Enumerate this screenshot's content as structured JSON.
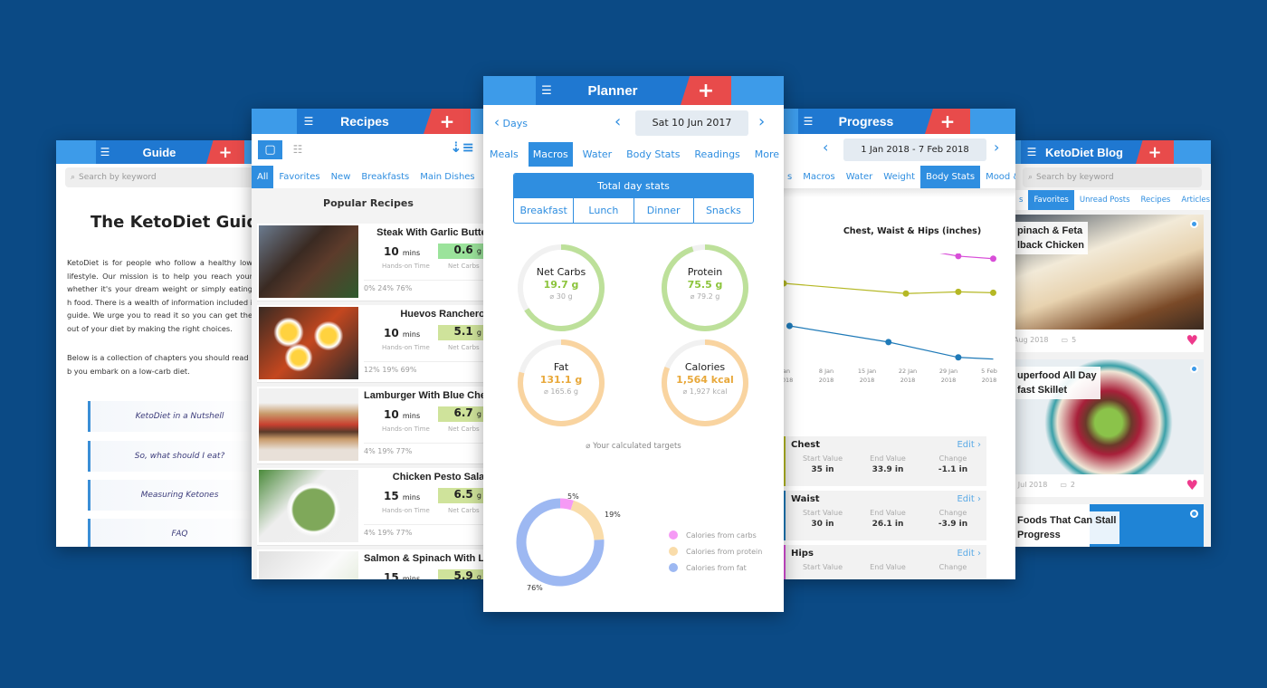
{
  "colors": {
    "background": "#0b4a85",
    "header": "#3d9be9",
    "accent": "#2f8ee0",
    "add": "#e84b4b",
    "carbs": "#f07cf0",
    "protein": "#f9d9a3",
    "fat": "#9db8f2",
    "ring_green": "#bde09a",
    "ring_orange": "#f9d4a0"
  },
  "guide": {
    "title": "Guide",
    "search_placeholder": "Search by keyword",
    "heading": "The KetoDiet Guide",
    "paragraph1": "KetoDiet is for people who follow a healthy low lifestyle. Our mission is to help you reach your whether it's your dream weight or simply eating h food. There is a wealth of information included i guide. We urge you to read it so you can get the out of your diet by making the right choices.",
    "paragraph2": "Below is a collection of chapters you should read b you embark on a low-carb diet.",
    "chapters": [
      "KetoDiet in a Nutshell",
      "So, what should I eat?",
      "Measuring Ketones",
      "FAQ"
    ]
  },
  "recipes": {
    "title": "Recipes",
    "tabs": [
      "All",
      "Favorites",
      "New",
      "Breakfasts",
      "Main Dishes"
    ],
    "active_tab": 0,
    "section_title": "Popular Recipes",
    "time_label": "Hands-on Time",
    "carbs_label": "Net Carbs",
    "items": [
      {
        "name": "Steak With Garlic Butter",
        "time": "10",
        "unit": "mins",
        "carbs": "0.6",
        "carb_unit": "g",
        "macros": "0%   24%   76%",
        "carb_color": "#9be39b",
        "img": "linear-gradient(135deg,#6b7b8f,#3a2a22 40%,#5c3b2b 60%,#2e5a2e)"
      },
      {
        "name": "Huevos Rancheros",
        "time": "10",
        "unit": "mins",
        "carbs": "5.1",
        "carb_unit": "g",
        "macros": "12%   19%   69%",
        "carb_color": "#cfe39b",
        "img": "radial-gradient(circle at 30% 35%,#ffd23f 9%,#fff 14%,transparent 18%),radial-gradient(circle at 70% 40%,#ffd23f 9%,#fff 14%,transparent 18%),radial-gradient(circle at 40% 70%,#ffd23f 9%,#fff 14%,transparent 18%),linear-gradient(135deg,#3a2a22,#c4471f 50%,#2a2a2a)"
      },
      {
        "name": "Lamburger With Blue Chee",
        "time": "10",
        "unit": "mins",
        "carbs": "6.7",
        "carb_unit": "g",
        "macros": "4%   19%   77%",
        "carb_color": "#cfe39b",
        "img": "linear-gradient(180deg,#f1f1f1 20%,#c89a6a 35%,#c84030 50%,#5a3a2a 60%,#c89a6a 70%,#e8e0d8 85%)"
      },
      {
        "name": "Chicken Pesto Salad",
        "time": "15",
        "unit": "mins",
        "carbs": "6.5",
        "carb_unit": "g",
        "macros": "4%   19%   77%",
        "carb_color": "#cfe39b",
        "img": "radial-gradient(circle at 55% 55%,#7fa85a 30%,#fff 33%,#f3f3f3 38%,transparent 40%),linear-gradient(135deg,#4a8a3a,#eeeeee 40%,#f0f0f0)"
      },
      {
        "name": "Salmon & Spinach With Lemon C",
        "time": "15",
        "unit": "mins",
        "carbs": "5.9",
        "carb_unit": "g",
        "macros": "",
        "carb_color": "#cfe39b",
        "img": "linear-gradient(135deg,#e0e0e0,#fafafa 50%,#d6e3c8)"
      }
    ]
  },
  "planner": {
    "title": "Planner",
    "back_label": "Days",
    "date": "Sat 10 Jun 2017",
    "tabs": [
      "Meals",
      "Macros",
      "Water",
      "Body Stats",
      "Readings",
      "More"
    ],
    "active_tab": 1,
    "total_label": "Total day stats",
    "meals": [
      "Breakfast",
      "Lunch",
      "Dinner",
      "Snacks"
    ],
    "rings": [
      {
        "name": "Net Carbs",
        "value": "19.7 g",
        "target": "⌀ 30 g",
        "progress": 0.66,
        "color": "#bde09a",
        "text_color": "#8cc43c"
      },
      {
        "name": "Protein",
        "value": "75.5 g",
        "target": "⌀ 79.2 g",
        "progress": 0.95,
        "color": "#bde09a",
        "text_color": "#8cc43c"
      },
      {
        "name": "Fat",
        "value": "131.1 g",
        "target": "⌀ 165.6 g",
        "progress": 0.79,
        "color": "#f9d4a0",
        "text_color": "#e8a83a"
      },
      {
        "name": "Calories",
        "value": "1,564 kcal",
        "target": "⌀ 1,927 kcal",
        "progress": 0.81,
        "color": "#f9d4a0",
        "text_color": "#e8a83a"
      }
    ],
    "targets_note": "⌀ Your calculated targets",
    "donut": [
      {
        "label": "Calories from carbs",
        "percent": 5,
        "pct_label": "5%",
        "color": "#f59af5"
      },
      {
        "label": "Calories from protein",
        "percent": 19,
        "pct_label": "19%",
        "color": "#f9dcaa"
      },
      {
        "label": "Calories from fat",
        "percent": 76,
        "pct_label": "76%",
        "color": "#9db8f2"
      }
    ]
  },
  "progress": {
    "title": "Progress",
    "date_range": "1 Jan 2018 - 7 Feb 2018",
    "tabs": [
      "s",
      "Macros",
      "Water",
      "Weight",
      "Body Stats",
      "Mood & E"
    ],
    "active_tab": 4,
    "stat_labels": [
      "Start Value",
      "End Value",
      "Change"
    ],
    "edit_label": "Edit",
    "stats": [
      {
        "name": "Chest",
        "start": "35 in",
        "end": "33.9 in",
        "change": "-1.1 in",
        "color": "#b5b825"
      },
      {
        "name": "Waist",
        "start": "30 in",
        "end": "26.1 in",
        "change": "-3.9 in",
        "color": "#1f7ab8"
      },
      {
        "name": "Hips",
        "start": "",
        "end": "",
        "change": "",
        "color": "#d84ed8"
      }
    ]
  },
  "chart_data": {
    "type": "line",
    "title": "Chest, Waist & Hips (inches)",
    "x_ticks": [
      [
        "Jan",
        "2018"
      ],
      [
        "8 Jan",
        "2018"
      ],
      [
        "15 Jan",
        "2018"
      ],
      [
        "22 Jan",
        "2018"
      ],
      [
        "29 Jan",
        "2018"
      ],
      [
        "5 Feb",
        "2018"
      ]
    ],
    "xlim": [
      "2018-01-01",
      "2018-02-07"
    ],
    "grid": false,
    "series": [
      {
        "name": "Hips",
        "color": "#d84ed8",
        "points": [
          [
            "2018-01-01",
            40.1
          ],
          [
            "2018-01-19",
            39.6
          ],
          [
            "2018-01-31",
            38.2
          ],
          [
            "2018-02-06",
            37.9
          ]
        ],
        "markers": [
          true,
          true,
          true,
          true
        ]
      },
      {
        "name": "Chest",
        "color": "#b5b825",
        "points": [
          [
            "2018-01-01",
            35.0
          ],
          [
            "2018-01-22",
            33.8
          ],
          [
            "2018-01-31",
            34.0
          ],
          [
            "2018-02-06",
            33.9
          ]
        ],
        "markers": [
          true,
          true,
          true,
          true
        ]
      },
      {
        "name": "Waist",
        "color": "#1f7ab8",
        "points": [
          [
            "2018-01-02",
            30.0
          ],
          [
            "2018-01-19",
            28.1
          ],
          [
            "2018-01-31",
            26.3
          ],
          [
            "2018-02-06",
            26.1
          ]
        ],
        "markers": [
          true,
          true,
          true,
          false
        ]
      }
    ]
  },
  "blog": {
    "title": "KetoDiet Blog",
    "search_placeholder": "Search by keyword",
    "tabs": [
      "s",
      "Favorites",
      "Unread Posts",
      "Recipes",
      "Articles",
      "Vi"
    ],
    "active_tab": 1,
    "posts": [
      {
        "title": "pinach & Feta\nlback Chicken",
        "date": "Aug 2018",
        "comments": "5",
        "img": "linear-gradient(160deg,#4a5562,#f2ead8 35%,#e8d3b0 55%,#7a4a28 80%,#3a2a20)",
        "fav": true
      },
      {
        "title": "uperfood All Day\nfast Skillet",
        "date": "l Jul 2018",
        "comments": "2",
        "img": "radial-gradient(circle at 50% 55%,#8bc34a 12%,#6a3a2a 20%,#a8203a 28%,#f0e6d6 45%,#3aa0a8 50%,#e8eef2 56%)",
        "fav": true
      },
      {
        "title": "Foods That Can Stall\nProgress",
        "date": "",
        "comments": "",
        "img": "linear-gradient(90deg,#ffffff 40%,#1f84d6 40%)",
        "fav": false
      }
    ]
  }
}
